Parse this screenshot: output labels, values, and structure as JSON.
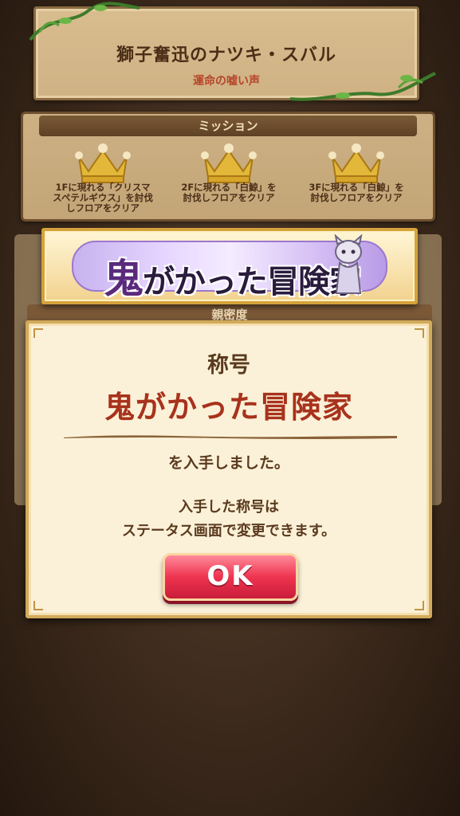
{
  "header": {
    "character_name": "獅子奮迅のナツキ・スバル",
    "subtitle": "運命の嘘い声"
  },
  "mission": {
    "heading": "ミッション",
    "items": [
      {
        "line1": "1Fに現れる「クリスマ",
        "line2": "スペテルギウス」を討伐",
        "line3": "しフロアをクリア"
      },
      {
        "line1": "2Fに現れる「白鯨」を",
        "line2": "討伐しフロアをクリア",
        "line3": ""
      },
      {
        "line1": "3Fに現れる「白鯨」を",
        "line2": "討伐しフロアをクリア",
        "line3": ""
      }
    ],
    "crown_color": "#e3b73a"
  },
  "background_panel": {
    "heading": "親密度"
  },
  "banner": {
    "title_big": "鬼",
    "title_rest": "がかった冒険家"
  },
  "dialog": {
    "label": "称号",
    "title": "鬼がかった冒険家",
    "obtained": "を入手しました。",
    "note_line1": "入手した称号は",
    "note_line2": "ステータス画面で変更できます。",
    "ok_label": "OK"
  }
}
